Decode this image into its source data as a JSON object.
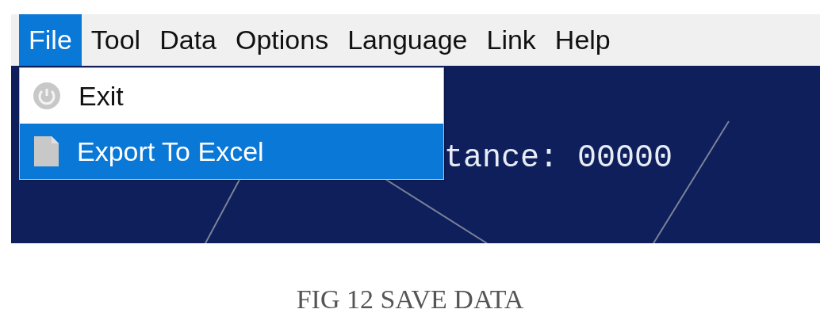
{
  "menu_bar": [
    {
      "label": "File",
      "selected": true
    },
    {
      "label": "Tool",
      "selected": false
    },
    {
      "label": "Data",
      "selected": false
    },
    {
      "label": "Options",
      "selected": false
    },
    {
      "label": "Language",
      "selected": false
    },
    {
      "label": "Link",
      "selected": false
    },
    {
      "label": "Help",
      "selected": false
    }
  ],
  "file_menu": [
    {
      "label": "Exit",
      "kind": "power",
      "selected": false
    },
    {
      "label": "Export To Excel",
      "kind": "file",
      "selected": true
    }
  ],
  "readout": "tance: 00000",
  "caption": "FIG 12 SAVE DATA"
}
